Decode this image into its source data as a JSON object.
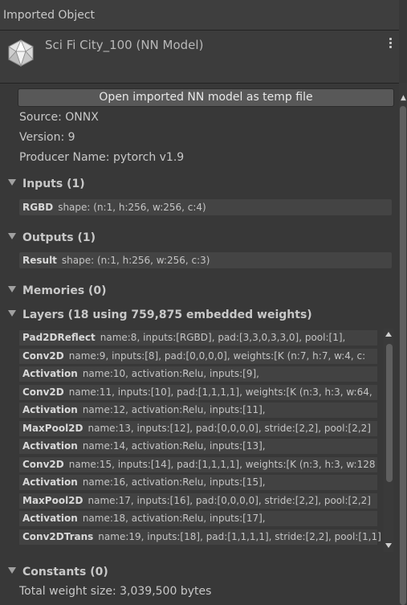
{
  "window": {
    "title": "Imported Object"
  },
  "header": {
    "title": "Sci Fi City_100 (NN Model)",
    "icon": "polyhedron-icon"
  },
  "open_button": {
    "label": "Open imported NN model as temp file"
  },
  "info": {
    "source": "Source: ONNX",
    "version": "Version: 9",
    "producer": "Producer Name: pytorch v1.9"
  },
  "inputs": {
    "title": "Inputs (1)",
    "items": [
      {
        "name": "RGBD",
        "detail": "shape: (n:1, h:256, w:256, c:4)"
      }
    ]
  },
  "outputs": {
    "title": "Outputs (1)",
    "items": [
      {
        "name": "Result",
        "detail": "shape: (n:1, h:256, w:256, c:3)"
      }
    ]
  },
  "memories": {
    "title": "Memories (0)"
  },
  "layers": {
    "title": "Layers (18 using 759,875 embedded weights)",
    "items": [
      {
        "name": "Pad2DReflect",
        "detail": "name:8, inputs:[RGBD], pad:[3,3,0,3,3,0], pool:[1],"
      },
      {
        "name": "Conv2D",
        "detail": "name:9, inputs:[8], pad:[0,0,0,0], weights:[K (n:7, h:7, w:4, c:"
      },
      {
        "name": "Activation",
        "detail": "name:10, activation:Relu, inputs:[9],"
      },
      {
        "name": "Conv2D",
        "detail": "name:11, inputs:[10], pad:[1,1,1,1], weights:[K (n:3, h:3, w:64,"
      },
      {
        "name": "Activation",
        "detail": "name:12, activation:Relu, inputs:[11],"
      },
      {
        "name": "MaxPool2D",
        "detail": "name:13, inputs:[12], pad:[0,0,0,0], stride:[2,2], pool:[2,2]"
      },
      {
        "name": "Activation",
        "detail": "name:14, activation:Relu, inputs:[13],"
      },
      {
        "name": "Conv2D",
        "detail": "name:15, inputs:[14], pad:[1,1,1,1], weights:[K (n:3, h:3, w:128"
      },
      {
        "name": "Activation",
        "detail": "name:16, activation:Relu, inputs:[15],"
      },
      {
        "name": "MaxPool2D",
        "detail": "name:17, inputs:[16], pad:[0,0,0,0], stride:[2,2], pool:[2,2]"
      },
      {
        "name": "Activation",
        "detail": "name:18, activation:Relu, inputs:[17],"
      },
      {
        "name": "Conv2DTrans",
        "detail": "name:19, inputs:[18], pad:[1,1,1,1], stride:[2,2], pool:[1,1]"
      }
    ]
  },
  "constants": {
    "title": "Constants (0)"
  },
  "total": {
    "label": "Total weight size: 3,039,500 bytes"
  }
}
